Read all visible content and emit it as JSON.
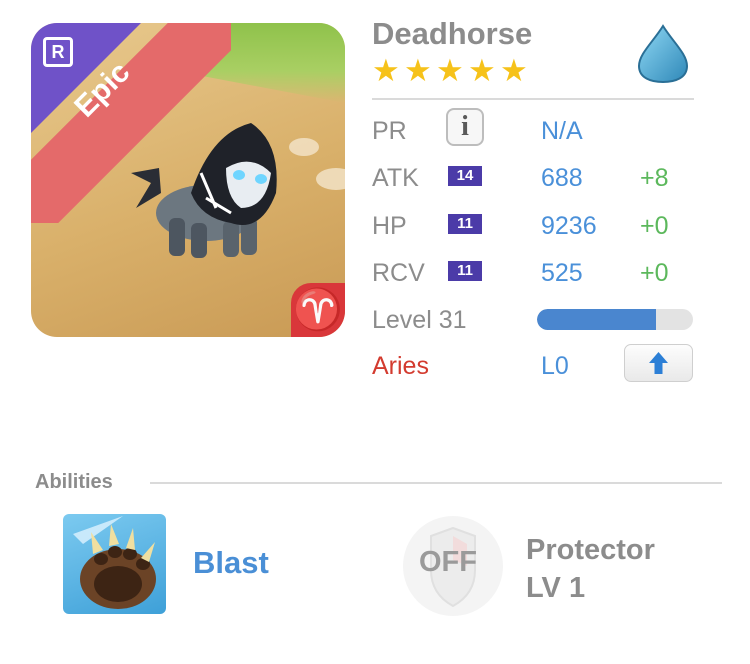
{
  "creature": {
    "name": "Deadhorse",
    "stars": 5,
    "rarity": "Epic",
    "rarity_icon": "R",
    "zodiac_glyph": "♈",
    "element_icon": "water-drop-icon"
  },
  "stats": {
    "pr": {
      "label": "PR",
      "value": "N/A"
    },
    "atk": {
      "label": "ATK",
      "badge": "14",
      "value": "688",
      "bonus": "+8"
    },
    "hp": {
      "label": "HP",
      "badge": "11",
      "value": "9236",
      "bonus": "+0"
    },
    "rcv": {
      "label": "RCV",
      "badge": "11",
      "value": "525",
      "bonus": "+0"
    }
  },
  "level": {
    "label": "Level 31",
    "progress": 0.76
  },
  "sign": {
    "label": "Aries",
    "level": "L0"
  },
  "abilities": {
    "title": "Abilities",
    "active": {
      "name": "Blast"
    },
    "passive": {
      "status": "OFF",
      "name_line1": "Protector",
      "name_line2": "LV 1"
    }
  },
  "colors": {
    "accent_blue": "#4a90d9",
    "bonus_green": "#5cb85c",
    "sign_red": "#d33b2f",
    "badge_purple": "#4b3ba8",
    "star_gold": "#f6c21a"
  }
}
